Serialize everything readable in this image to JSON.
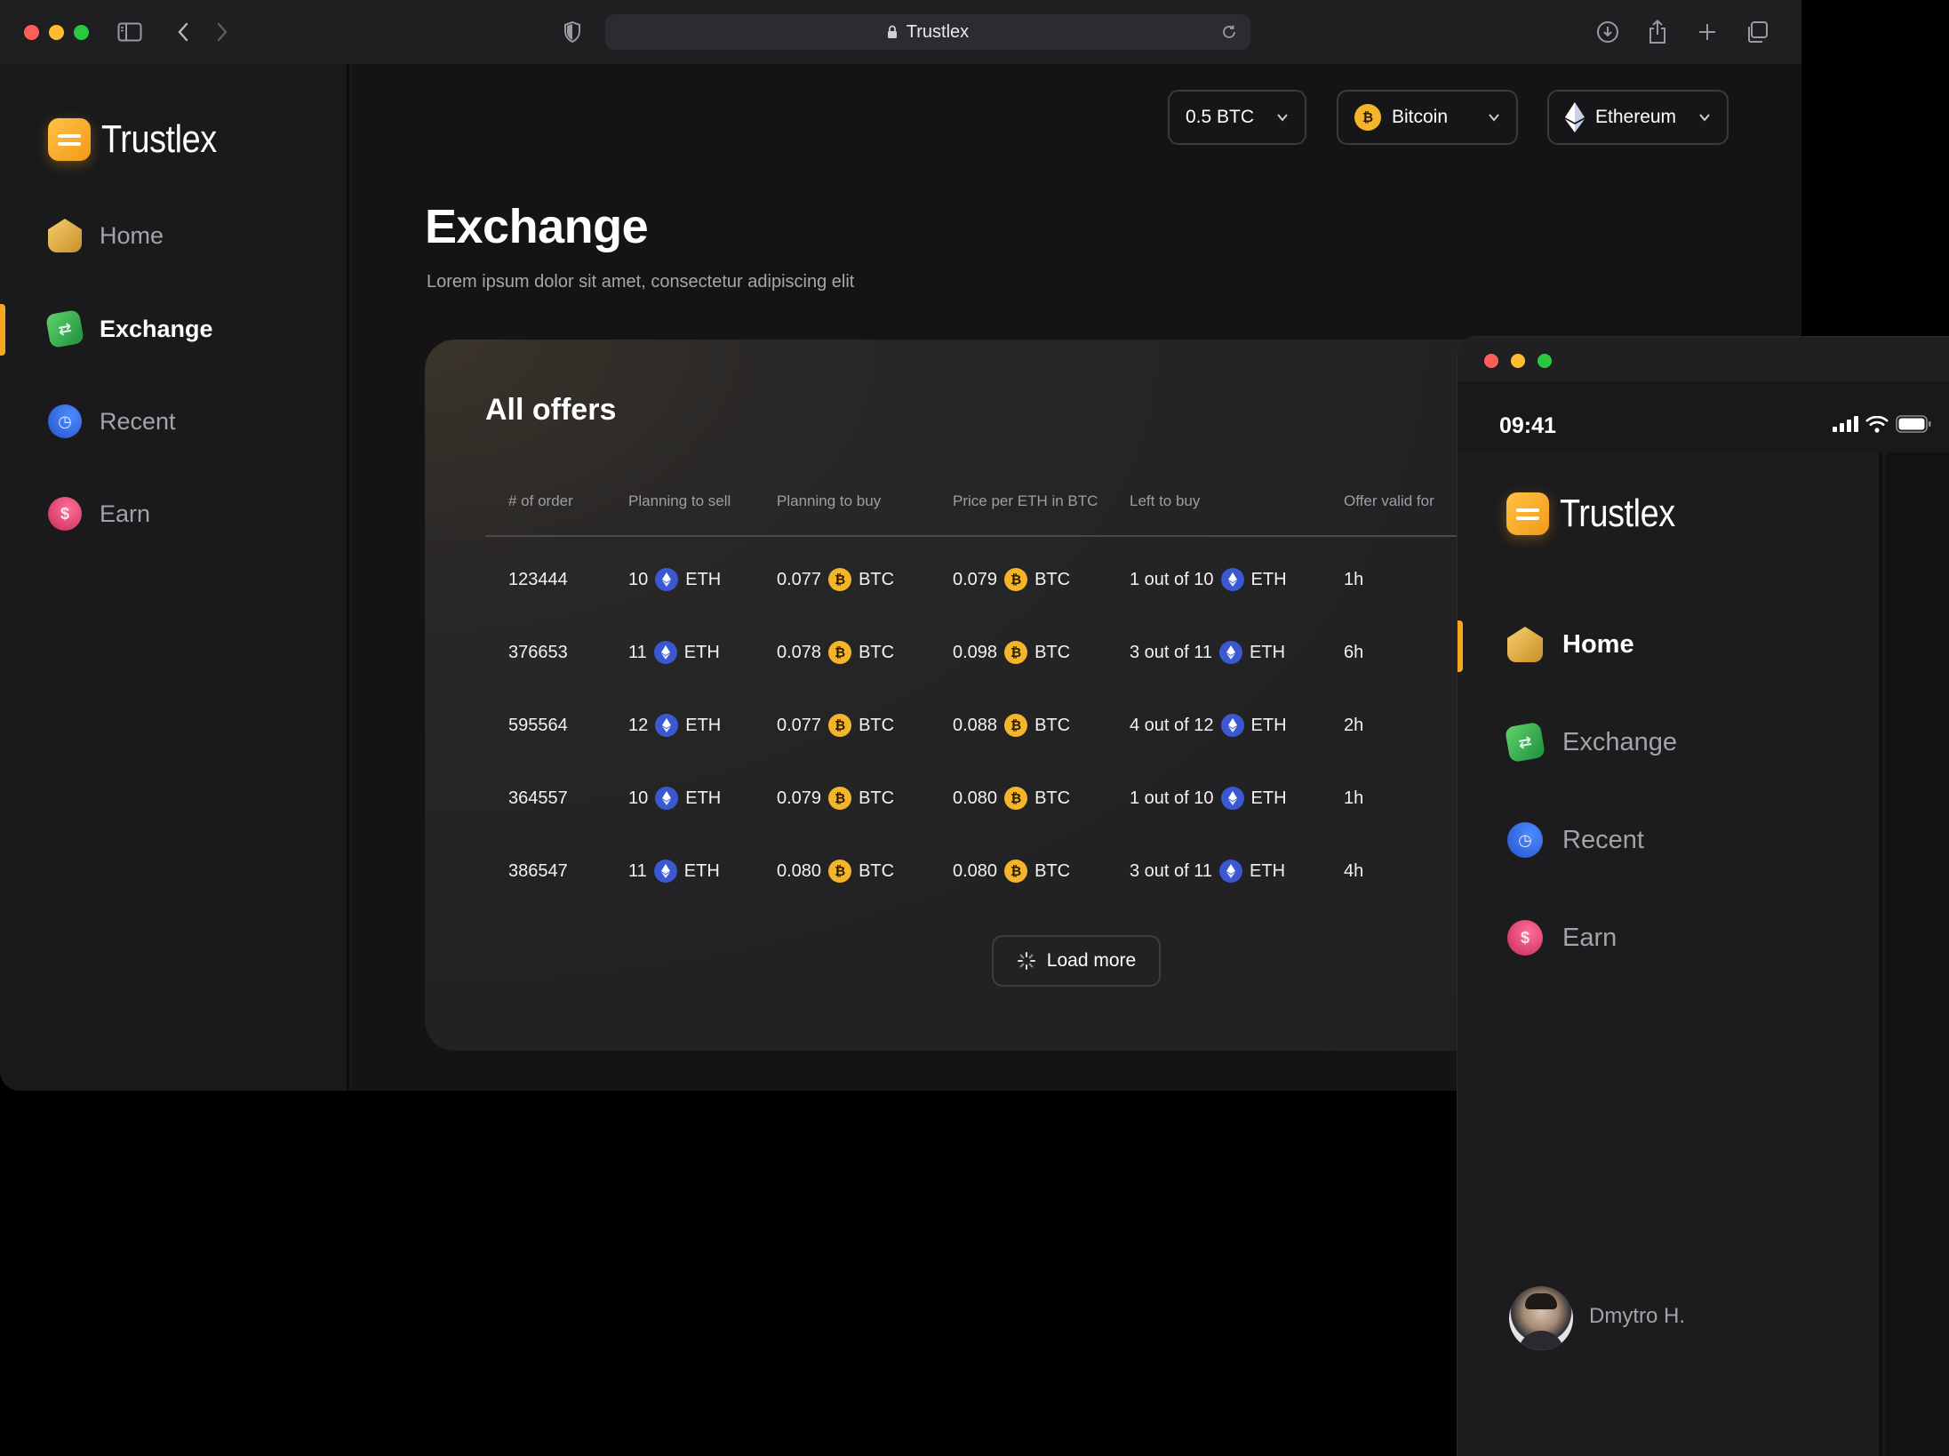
{
  "browser": {
    "url_title": "Trustlex"
  },
  "brand": {
    "name": "Trustlex"
  },
  "sidebar": {
    "items": [
      {
        "label": "Home",
        "icon": "home-icon"
      },
      {
        "label": "Exchange",
        "icon": "exchange-icon"
      },
      {
        "label": "Recent",
        "icon": "recent-icon"
      },
      {
        "label": "Earn",
        "icon": "earn-icon"
      }
    ],
    "active": "Exchange"
  },
  "topbar": {
    "amount": "0.5 BTC",
    "from_coin": "Bitcoin",
    "to_coin": "Ethereum"
  },
  "page": {
    "title": "Exchange",
    "subtitle": "Lorem ipsum dolor sit amet, consectetur adipiscing elit"
  },
  "offers": {
    "title": "All offers",
    "columns": [
      "# of order",
      "Planning to sell",
      "Planning to buy",
      "Price per ETH in BTC",
      "Left to buy",
      "Offer valid for"
    ],
    "rows": [
      {
        "order": "123444",
        "sell_amount": "10",
        "sell_unit": "ETH",
        "buy_amount": "0.077",
        "buy_unit": "BTC",
        "price": "0.079",
        "price_unit": "BTC",
        "left": "1 out of 10",
        "left_unit": "ETH",
        "valid": "1h"
      },
      {
        "order": "376653",
        "sell_amount": "11",
        "sell_unit": "ETH",
        "buy_amount": "0.078",
        "buy_unit": "BTC",
        "price": "0.098",
        "price_unit": "BTC",
        "left": "3 out of 11",
        "left_unit": "ETH",
        "valid": "6h"
      },
      {
        "order": "595564",
        "sell_amount": "12",
        "sell_unit": "ETH",
        "buy_amount": "0.077",
        "buy_unit": "BTC",
        "price": "0.088",
        "price_unit": "BTC",
        "left": "4 out of 12",
        "left_unit": "ETH",
        "valid": "2h"
      },
      {
        "order": "364557",
        "sell_amount": "10",
        "sell_unit": "ETH",
        "buy_amount": "0.079",
        "buy_unit": "BTC",
        "price": "0.080",
        "price_unit": "BTC",
        "left": "1 out of 10",
        "left_unit": "ETH",
        "valid": "1h"
      },
      {
        "order": "386547",
        "sell_amount": "11",
        "sell_unit": "ETH",
        "buy_amount": "0.080",
        "buy_unit": "BTC",
        "price": "0.080",
        "price_unit": "BTC",
        "left": "3 out of 11",
        "left_unit": "ETH",
        "valid": "4h"
      }
    ],
    "load_more": "Load more"
  },
  "mobile": {
    "time": "09:41",
    "brand": "Trustlex",
    "items": [
      {
        "label": "Home"
      },
      {
        "label": "Exchange"
      },
      {
        "label": "Recent"
      },
      {
        "label": "Earn"
      }
    ],
    "active": "Home",
    "user_name": "Dmytro H."
  },
  "colors": {
    "accent": "#f5a623",
    "eth": "#3a59d1",
    "btc": "#f5b52a",
    "background": "#141416"
  }
}
